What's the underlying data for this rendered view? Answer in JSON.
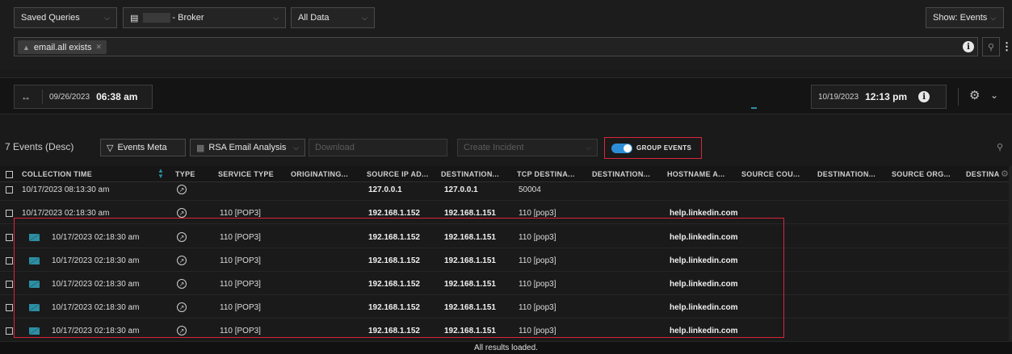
{
  "top_bar": {
    "saved_queries": "Saved Queries",
    "broker": "- Broker",
    "all_data": "All Data",
    "show_events": "Show: Events"
  },
  "query": {
    "pill_text": "email.all exists"
  },
  "time_range": {
    "start_date": "09/26/2023",
    "start_time": "06:38 am",
    "end_date": "10/19/2023",
    "end_time": "12:13 pm"
  },
  "toolbar": {
    "events_count": "7 Events (Desc)",
    "events_meta": "Events Meta",
    "profile": "RSA Email Analysis",
    "download": "Download",
    "create_incident": "Create Incident",
    "group_events": "GROUP EVENTS"
  },
  "columns": [
    "COLLECTION TIME",
    "TYPE",
    "SERVICE TYPE",
    "ORIGINATING...",
    "SOURCE IP AD...",
    "DESTINATION...",
    "TCP DESTINA...",
    "DESTINATION...",
    "HOSTNAME A...",
    "SOURCE COU...",
    "DESTINATION...",
    "SOURCE ORG...",
    "DESTINA"
  ],
  "rows": [
    {
      "time": "10/17/2023 08:13:30 am",
      "service": "",
      "src": "127.0.0.1",
      "dst": "127.0.0.1",
      "tcp": "50004",
      "host": "",
      "grouped": false
    },
    {
      "time": "10/17/2023 02:18:30 am",
      "service": "110 [POP3]",
      "src": "192.168.1.152",
      "dst": "192.168.1.151",
      "tcp": "110 [pop3]",
      "host": "help.linkedin.com",
      "grouped": false
    },
    {
      "time": "10/17/2023 02:18:30 am",
      "service": "110 [POP3]",
      "src": "192.168.1.152",
      "dst": "192.168.1.151",
      "tcp": "110 [pop3]",
      "host": "help.linkedin.com",
      "grouped": true
    },
    {
      "time": "10/17/2023 02:18:30 am",
      "service": "110 [POP3]",
      "src": "192.168.1.152",
      "dst": "192.168.1.151",
      "tcp": "110 [pop3]",
      "host": "help.linkedin.com",
      "grouped": true
    },
    {
      "time": "10/17/2023 02:18:30 am",
      "service": "110 [POP3]",
      "src": "192.168.1.152",
      "dst": "192.168.1.151",
      "tcp": "110 [pop3]",
      "host": "help.linkedin.com",
      "grouped": true
    },
    {
      "time": "10/17/2023 02:18:30 am",
      "service": "110 [POP3]",
      "src": "192.168.1.152",
      "dst": "192.168.1.151",
      "tcp": "110 [pop3]",
      "host": "help.linkedin.com",
      "grouped": true
    },
    {
      "time": "10/17/2023 02:18:30 am",
      "service": "110 [POP3]",
      "src": "192.168.1.152",
      "dst": "192.168.1.151",
      "tcp": "110 [pop3]",
      "host": "help.linkedin.com",
      "grouped": true
    }
  ],
  "footer": {
    "status": "All results loaded."
  },
  "colors": {
    "highlight": "#d9263a",
    "toggle_on": "#2d8ed8",
    "envelope": "#2c8fa3"
  }
}
